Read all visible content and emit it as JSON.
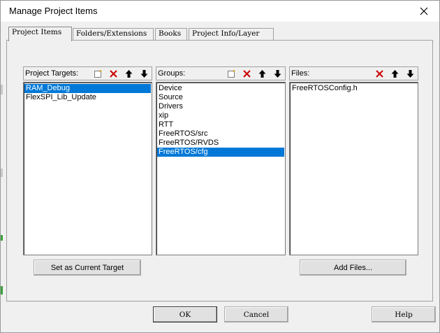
{
  "window": {
    "title": "Manage Project Items"
  },
  "tabs": [
    {
      "label": "Project Items"
    },
    {
      "label": "Folders/Extensions"
    },
    {
      "label": "Books"
    },
    {
      "label": "Project Info/Layer"
    }
  ],
  "targets": {
    "label": "Project Targets:",
    "items": [
      "RAM_Debug",
      "FlexSPI_Lib_Update"
    ],
    "selected_index": 0,
    "set_current_label": "Set as Current Target"
  },
  "groups": {
    "label": "Groups:",
    "items": [
      "Device",
      "Source",
      "Drivers",
      "xip",
      "RTT",
      "FreeRTOS/src",
      "FreeRTOS/RVDS",
      "FreeRTOS/cfg"
    ],
    "selected_index": 7
  },
  "files": {
    "label": "Files:",
    "items": [
      "FreeRTOSConfig.h"
    ],
    "add_files_label": "Add Files..."
  },
  "footer": {
    "ok_label": "OK",
    "cancel_label": "Cancel",
    "help_label": "Help"
  },
  "icons": {
    "new": "new-item-icon",
    "delete": "delete-icon",
    "up": "move-up-icon",
    "down": "move-down-icon",
    "close": "close-icon"
  },
  "colors": {
    "selection": "#0078d7",
    "delete_red": "#cc0000"
  }
}
